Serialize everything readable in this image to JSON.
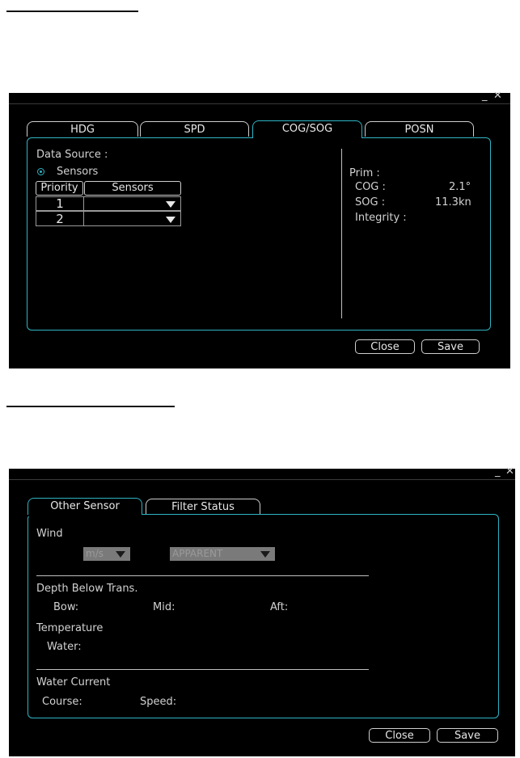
{
  "panel1": {
    "tabs": [
      {
        "label": "HDG",
        "active": false
      },
      {
        "label": "SPD",
        "active": false
      },
      {
        "label": "COG/SOG",
        "active": true
      },
      {
        "label": "POSN",
        "active": false
      }
    ],
    "data_source_label": "Data Source :",
    "radio_label": "Sensors",
    "table": {
      "headers": [
        "Priority",
        "Sensors"
      ],
      "rows": [
        {
          "priority": "1",
          "sensor": ""
        },
        {
          "priority": "2",
          "sensor": ""
        }
      ]
    },
    "info": {
      "prim_label": "Prim :",
      "cog_label": "COG :",
      "cog_value": "2.1°",
      "sog_label": "SOG :",
      "sog_value": "11.3kn",
      "integrity_label": "Integrity :"
    },
    "buttons": {
      "close": "Close",
      "save": "Save"
    }
  },
  "panel2": {
    "tabs": [
      {
        "label": "Other Sensor",
        "active": true
      },
      {
        "label": "Filter Status",
        "active": false
      }
    ],
    "wind_label": "Wind",
    "wind_unit_dd": "m/s",
    "wind_mode_dd": "APPARENT",
    "depth_label": "Depth Below Trans.",
    "bow_label": "Bow:",
    "mid_label": "Mid:",
    "aft_label": "Aft:",
    "temperature_label": "Temperature",
    "water_label": "Water:",
    "current_label": "Water Current",
    "course_label": "Course:",
    "speed_label": "Speed:",
    "buttons": {
      "close": "Close",
      "save": "Save"
    }
  },
  "colors": {
    "accent": "#2fb4c4",
    "background": "#000000",
    "text": "#dcdcdc"
  }
}
